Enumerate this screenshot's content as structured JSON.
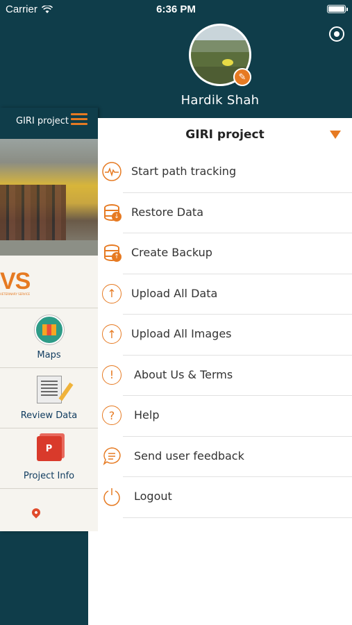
{
  "status_bar": {
    "carrier": "Carrier",
    "time": "6:36 PM"
  },
  "background_screen": {
    "header_title": "GIRI project",
    "logo_text": "VS",
    "logo_subtext": "VETERINARY SERVICE",
    "tiles": [
      {
        "label": "Maps",
        "icon": "map-icon"
      },
      {
        "label": "Review Data",
        "icon": "document-edit-icon"
      },
      {
        "label": "Project Info",
        "icon": "powerpoint-icon"
      },
      {
        "label": "",
        "icon": "location-pin-icon"
      }
    ]
  },
  "drawer": {
    "user_name": "Hardik Shah",
    "project": "GIRI project",
    "menu": [
      {
        "label": "Start path tracking",
        "icon": "path-tracking-icon"
      },
      {
        "label": "Restore Data",
        "icon": "restore-database-icon"
      },
      {
        "label": "Create Backup",
        "icon": "backup-database-icon"
      },
      {
        "label": "Upload All Data",
        "icon": "upload-icon"
      },
      {
        "label": "Upload All Images",
        "icon": "upload-icon"
      },
      {
        "label": "About Us & Terms",
        "icon": "info-exclamation-icon"
      },
      {
        "label": "Help",
        "icon": "help-icon"
      },
      {
        "label": "Send user feedback",
        "icon": "feedback-icon"
      },
      {
        "label": "Logout",
        "icon": "power-icon"
      }
    ]
  },
  "colors": {
    "header": "#0f3d4a",
    "accent": "#e67a22",
    "text": "#333333",
    "tile_label": "#0e3a5e"
  }
}
